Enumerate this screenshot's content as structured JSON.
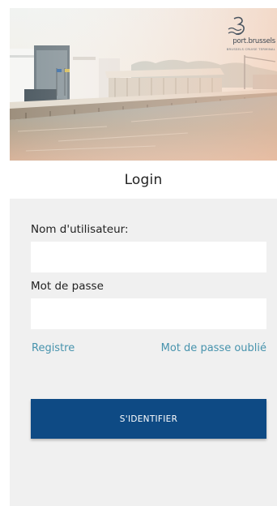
{
  "brand": {
    "name": "port.brussels",
    "subtitle": "BRUSSELS CRUISE TERMINAL"
  },
  "header": {
    "title": "Login"
  },
  "form": {
    "username_label": "Nom d'utilisateur:",
    "username_value": "",
    "password_label": "Mot de passe",
    "password_value": "",
    "register_link": "Registre",
    "forgot_link": "Mot de passe oublié",
    "submit_label": "S'IDENTIFIER"
  },
  "colors": {
    "primary_button": "#0e4a84",
    "link": "#4793ad",
    "panel_background": "#f0f0f0"
  }
}
